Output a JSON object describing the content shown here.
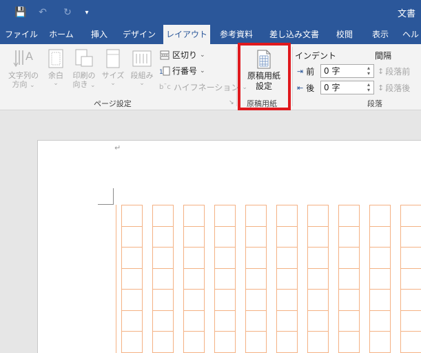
{
  "titlebar": {
    "doc_title": "文書",
    "quick_access": {
      "save": "💾",
      "undo": "↶",
      "redo": "↻",
      "customize": "▾"
    }
  },
  "tabs": [
    {
      "label": "ファイル"
    },
    {
      "label": "ホーム"
    },
    {
      "label": "挿入"
    },
    {
      "label": "デザイン"
    },
    {
      "label": "レイアウト"
    },
    {
      "label": "参考資料"
    },
    {
      "label": "差し込み文書"
    },
    {
      "label": "校閲"
    },
    {
      "label": "表示"
    },
    {
      "label": "ヘル"
    }
  ],
  "page_setup": {
    "text_direction": {
      "line1": "文字列の",
      "line2": "方向",
      "chevron": "⌄"
    },
    "margins": {
      "line1": "余白",
      "chevron": "⌄"
    },
    "orientation": {
      "line1": "印刷の",
      "line2": "向き",
      "chevron": "⌄"
    },
    "size": {
      "line1": "サイズ",
      "chevron": "⌄"
    },
    "columns": {
      "line1": "段組み",
      "chevron": "⌄"
    },
    "breaks": {
      "label": "区切り",
      "chevron": "⌄"
    },
    "line_numbers": {
      "label": "行番号",
      "chevron": "⌄"
    },
    "hyphenation": {
      "label": "ハイフネーション",
      "chevron": "⌄"
    },
    "group_label": "ページ設定"
  },
  "genko": {
    "button": {
      "line1": "原稿用紙",
      "line2": "設定"
    },
    "group_label": "原稿用紙"
  },
  "paragraph": {
    "indent_header": "インデント",
    "spacing_header": "間隔",
    "before_label": "前",
    "after_label": "後",
    "before_value": "0 字",
    "after_value": "0 字",
    "spacing_before": "段落前",
    "spacing_after": "段落後",
    "group_label": "段落"
  },
  "document": {
    "para_mark": "↵"
  },
  "colors": {
    "title_bar": "#2b579a",
    "ribbon": "#f3f3f3",
    "highlight_box": "#e0191e",
    "grid_lines": "#f4b183"
  }
}
